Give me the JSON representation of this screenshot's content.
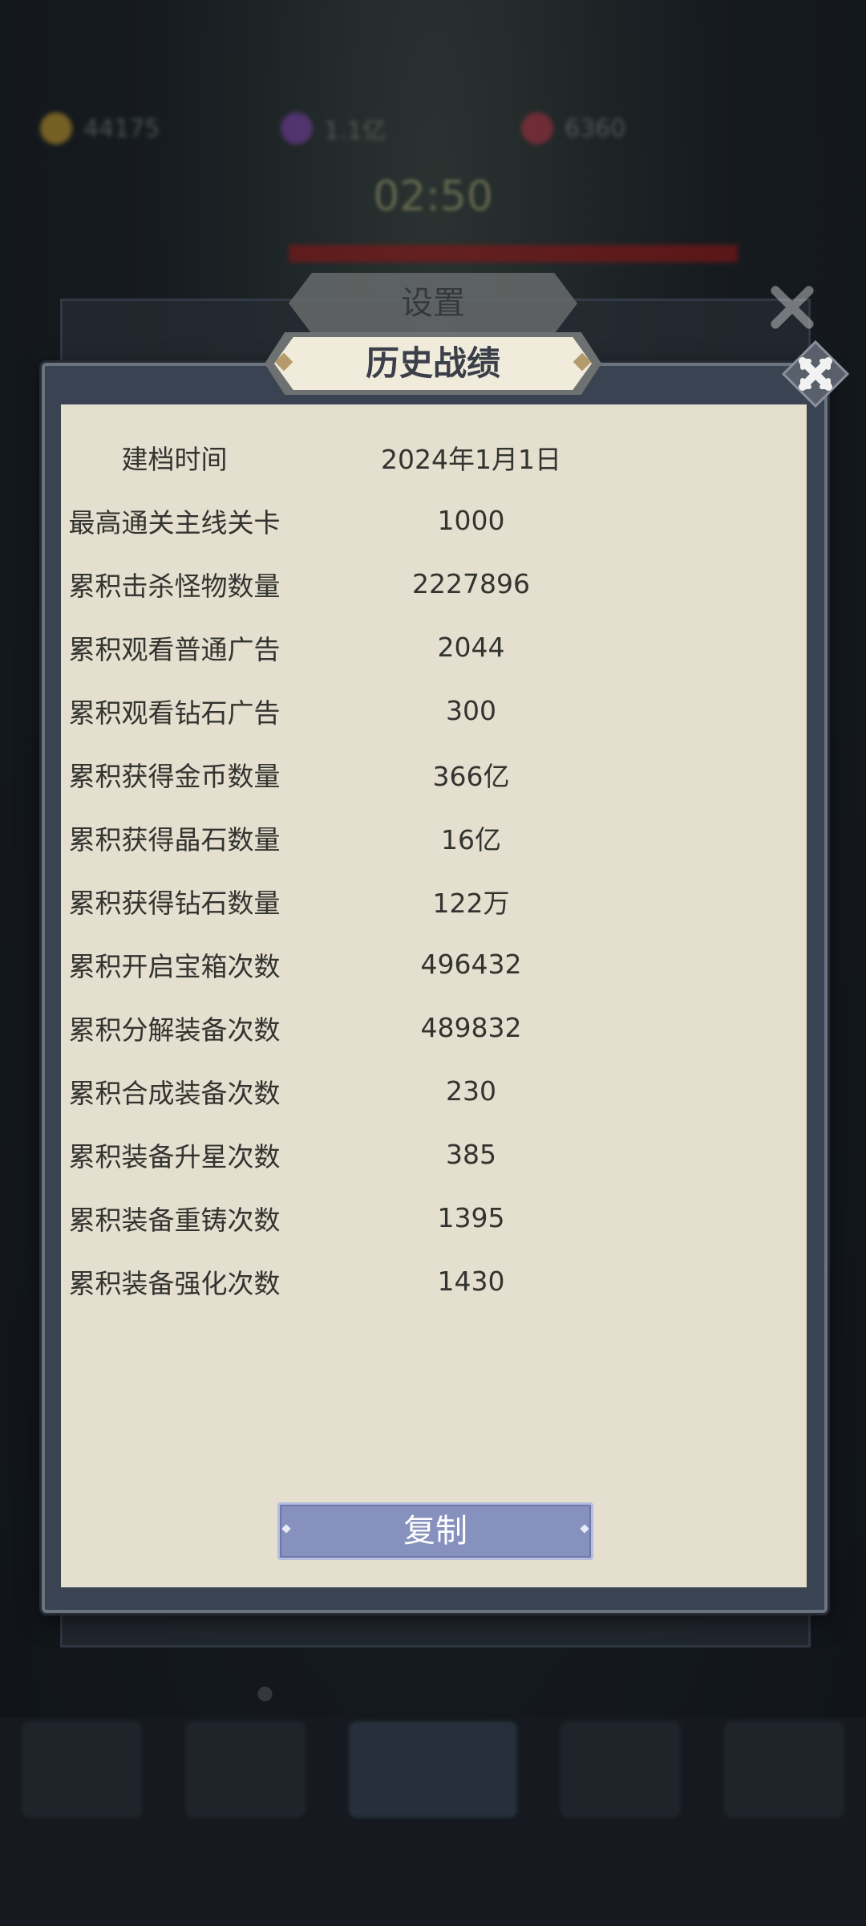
{
  "background": {
    "resources": [
      {
        "icon": "gold-coin-icon",
        "value": "44175",
        "color": "#c59a2a"
      },
      {
        "icon": "purple-crystal-icon",
        "value": "1.1亿",
        "color": "#7a3fa8"
      },
      {
        "icon": "red-gem-icon",
        "value": "6360",
        "color": "#b03040"
      }
    ],
    "timer": "02:50",
    "settings_tab": "设置"
  },
  "dialog": {
    "title": "历史战绩",
    "rows": [
      {
        "label": "建档时间",
        "value": "2024年1月1日"
      },
      {
        "label": "最高通关主线关卡",
        "value": "1000"
      },
      {
        "label": "累积击杀怪物数量",
        "value": "2227896"
      },
      {
        "label": "累积观看普通广告",
        "value": "2044"
      },
      {
        "label": "累积观看钻石广告",
        "value": "300"
      },
      {
        "label": "累积获得金币数量",
        "value": "366亿"
      },
      {
        "label": "累积获得晶石数量",
        "value": "16亿"
      },
      {
        "label": "累积获得钻石数量",
        "value": "122万"
      },
      {
        "label": "累积开启宝箱次数",
        "value": "496432"
      },
      {
        "label": "累积分解装备次数",
        "value": "489832"
      },
      {
        "label": "累积合成装备次数",
        "value": "230"
      },
      {
        "label": "累积装备升星次数",
        "value": "385"
      },
      {
        "label": "累积装备重铸次数",
        "value": "1395"
      },
      {
        "label": "累积装备强化次数",
        "value": "1430"
      }
    ],
    "copy_button": "复制"
  },
  "colors": {
    "panel": "#3a4351",
    "paper": "#e4dfcf",
    "button": "#8791bd"
  }
}
